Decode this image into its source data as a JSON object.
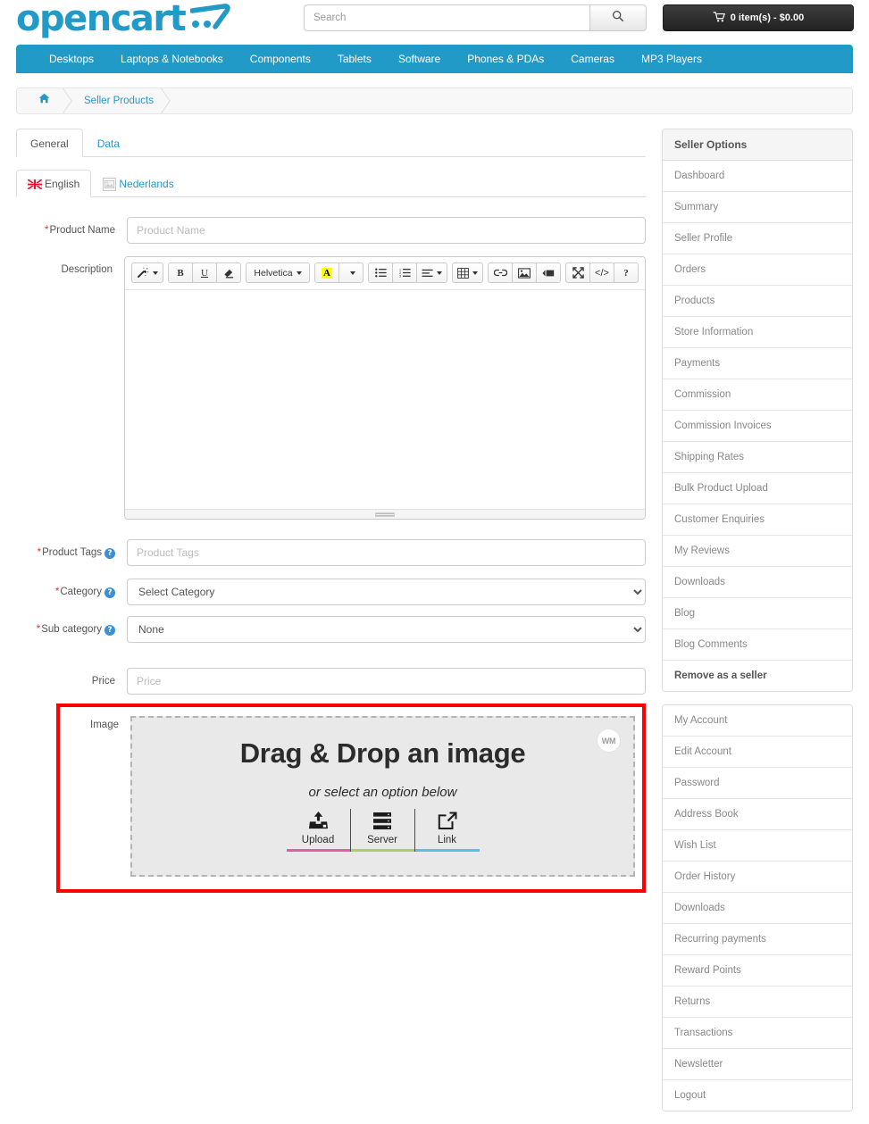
{
  "header": {
    "logo_text": "opencart",
    "search_placeholder": "Search",
    "search_value": "",
    "search_button_icon": "search-icon",
    "cart_label": "0 item(s) - $0.00"
  },
  "nav": {
    "items": [
      "Desktops",
      "Laptops & Notebooks",
      "Components",
      "Tablets",
      "Software",
      "Phones & PDAs",
      "Cameras",
      "MP3 Players"
    ]
  },
  "breadcrumb": {
    "home_icon": "home-icon",
    "items": [
      "Seller Products"
    ]
  },
  "tabs": {
    "items": [
      {
        "label": "General",
        "active": true
      },
      {
        "label": "Data",
        "active": false
      }
    ]
  },
  "language_tabs": {
    "items": [
      {
        "label": "English",
        "icon": "flag-gb-icon",
        "active": true
      },
      {
        "label": "Nederlands",
        "icon": "broken-image-icon",
        "active": false
      }
    ]
  },
  "form": {
    "product_name": {
      "label": "Product Name",
      "required": true,
      "placeholder": "Product Name",
      "value": ""
    },
    "description": {
      "label": "Description",
      "required": false,
      "value": ""
    },
    "product_tags": {
      "label": "Product Tags",
      "required": true,
      "help": "?",
      "placeholder": "Product Tags",
      "value": ""
    },
    "category": {
      "label": "Category",
      "required": true,
      "help": "?",
      "value": "Select Category",
      "options": [
        "Select Category"
      ]
    },
    "sub_category": {
      "label": "Sub category",
      "required": true,
      "help": "?",
      "value": "None",
      "options": [
        "None"
      ]
    },
    "price": {
      "label": "Price",
      "required": false,
      "placeholder": "Price",
      "value": ""
    },
    "image": {
      "label": "Image"
    }
  },
  "editor_toolbar": {
    "groups": [
      [
        {
          "name": "magic-wand-icon",
          "glyph": "style",
          "caret": true
        }
      ],
      [
        {
          "name": "bold-icon",
          "glyph": "B"
        },
        {
          "name": "underline-icon",
          "glyph": "U"
        },
        {
          "name": "eraser-icon",
          "glyph": "eraser"
        }
      ],
      [
        {
          "name": "font-name-select",
          "glyph": "Helvetica",
          "caret": true
        }
      ],
      [
        {
          "name": "font-color-icon",
          "glyph": "A"
        },
        {
          "name": "font-color-dropdown-icon",
          "glyph": "",
          "caret": true
        }
      ],
      [
        {
          "name": "unordered-list-icon",
          "glyph": "ul"
        },
        {
          "name": "ordered-list-icon",
          "glyph": "ol"
        },
        {
          "name": "paragraph-align-icon",
          "glyph": "align",
          "caret": true
        }
      ],
      [
        {
          "name": "table-icon",
          "glyph": "table",
          "caret": true
        }
      ],
      [
        {
          "name": "link-icon",
          "glyph": "link"
        },
        {
          "name": "picture-icon",
          "glyph": "picture"
        },
        {
          "name": "video-icon",
          "glyph": "video"
        }
      ],
      [
        {
          "name": "fullscreen-icon",
          "glyph": "fullscreen"
        },
        {
          "name": "code-view-icon",
          "glyph": "</>"
        },
        {
          "name": "help-icon",
          "glyph": "?"
        }
      ]
    ]
  },
  "dropzone": {
    "title": "Drag & Drop an image",
    "subtitle": "or select an option below",
    "watermark": "WM",
    "options": [
      {
        "label": "Upload",
        "icon": "upload-icon",
        "color": "#e0609f"
      },
      {
        "label": "Server",
        "icon": "server-icon",
        "color": "#aacf6a"
      },
      {
        "label": "Link",
        "icon": "external-link-icon",
        "color": "#5bc0de"
      }
    ]
  },
  "sidebar": {
    "seller_options": {
      "title": "Seller Options",
      "items": [
        {
          "label": "Dashboard",
          "bold": false
        },
        {
          "label": "Summary",
          "bold": false
        },
        {
          "label": "Seller Profile",
          "bold": false
        },
        {
          "label": "Orders",
          "bold": false
        },
        {
          "label": "Products",
          "bold": false
        },
        {
          "label": "Store Information",
          "bold": false
        },
        {
          "label": "Payments",
          "bold": false
        },
        {
          "label": "Commission",
          "bold": false
        },
        {
          "label": "Commission Invoices",
          "bold": false
        },
        {
          "label": "Shipping Rates",
          "bold": false
        },
        {
          "label": "Bulk Product Upload",
          "bold": false
        },
        {
          "label": "Customer Enquiries",
          "bold": false
        },
        {
          "label": "My Reviews",
          "bold": false
        },
        {
          "label": "Downloads",
          "bold": false
        },
        {
          "label": "Blog",
          "bold": false
        },
        {
          "label": "Blog Comments",
          "bold": false
        },
        {
          "label": "Remove as a seller",
          "bold": true
        }
      ]
    },
    "my_account": {
      "items": [
        {
          "label": "My Account"
        },
        {
          "label": "Edit Account"
        },
        {
          "label": "Password"
        },
        {
          "label": "Address Book"
        },
        {
          "label": "Wish List"
        },
        {
          "label": "Order History"
        },
        {
          "label": "Downloads"
        },
        {
          "label": "Recurring payments"
        },
        {
          "label": "Reward Points"
        },
        {
          "label": "Returns"
        },
        {
          "label": "Transactions"
        },
        {
          "label": "Newsletter"
        },
        {
          "label": "Logout"
        }
      ]
    }
  },
  "colors": {
    "brand": "#229ac8",
    "required": "#e4312b",
    "highlight_border": "#fe0000",
    "cart_button": "#222222",
    "dropzone_bg": "#e9e9e9"
  }
}
